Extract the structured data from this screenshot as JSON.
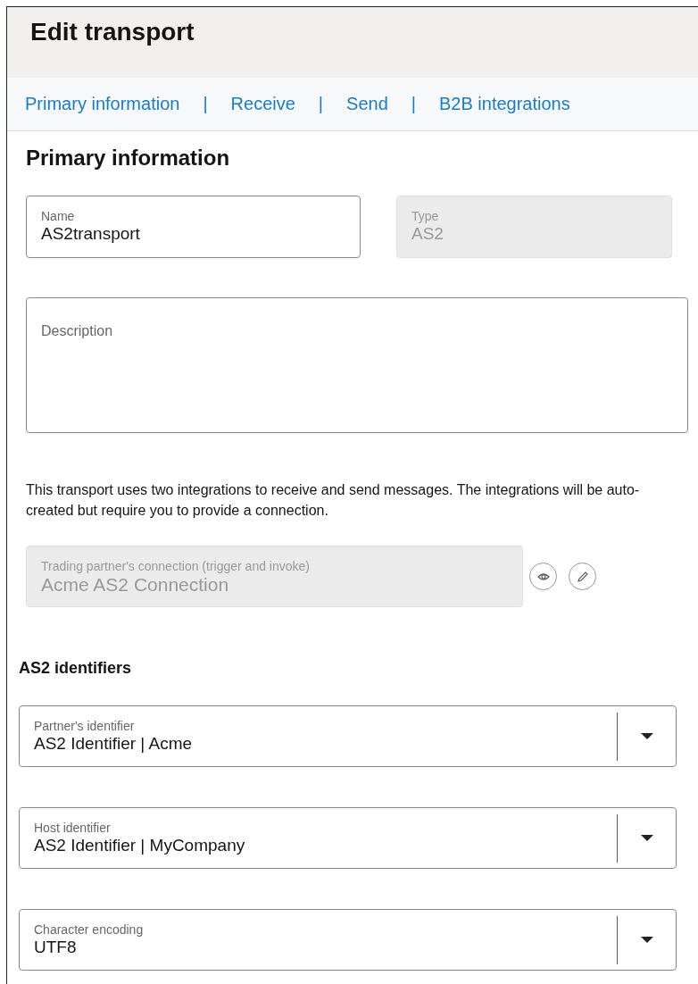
{
  "header": {
    "title": "Edit transport"
  },
  "nav": [
    {
      "kind": "link",
      "label": "Primary information"
    },
    {
      "kind": "separator",
      "label": "|"
    },
    {
      "kind": "link",
      "label": "Receive"
    },
    {
      "kind": "separator",
      "label": "|"
    },
    {
      "kind": "link",
      "label": "Send"
    },
    {
      "kind": "separator",
      "label": "|"
    },
    {
      "kind": "link",
      "label": "B2B integrations"
    }
  ],
  "section_title": "Primary information",
  "name_field": {
    "label": "Name",
    "value": "AS2transport",
    "disabled": false
  },
  "type_field": {
    "label": "Type",
    "value": "AS2",
    "disabled": true
  },
  "description_field": {
    "label": "Description"
  },
  "info_text": "This transport uses two integrations to receive and send messages. The integrations will be auto-created but require you to provide a connection.",
  "connection_field": {
    "label": "Trading partner's connection (trigger and invoke)",
    "value": "Acme AS2 Connection",
    "disabled": true
  },
  "identifiers_title": "AS2 identifiers",
  "selects": [
    {
      "label": "Partner's identifier",
      "value": "AS2 Identifier | Acme"
    },
    {
      "label": "Host identifier",
      "value": "AS2 Identifier | MyCompany"
    },
    {
      "label": "Character encoding",
      "value": "UTF8"
    }
  ]
}
